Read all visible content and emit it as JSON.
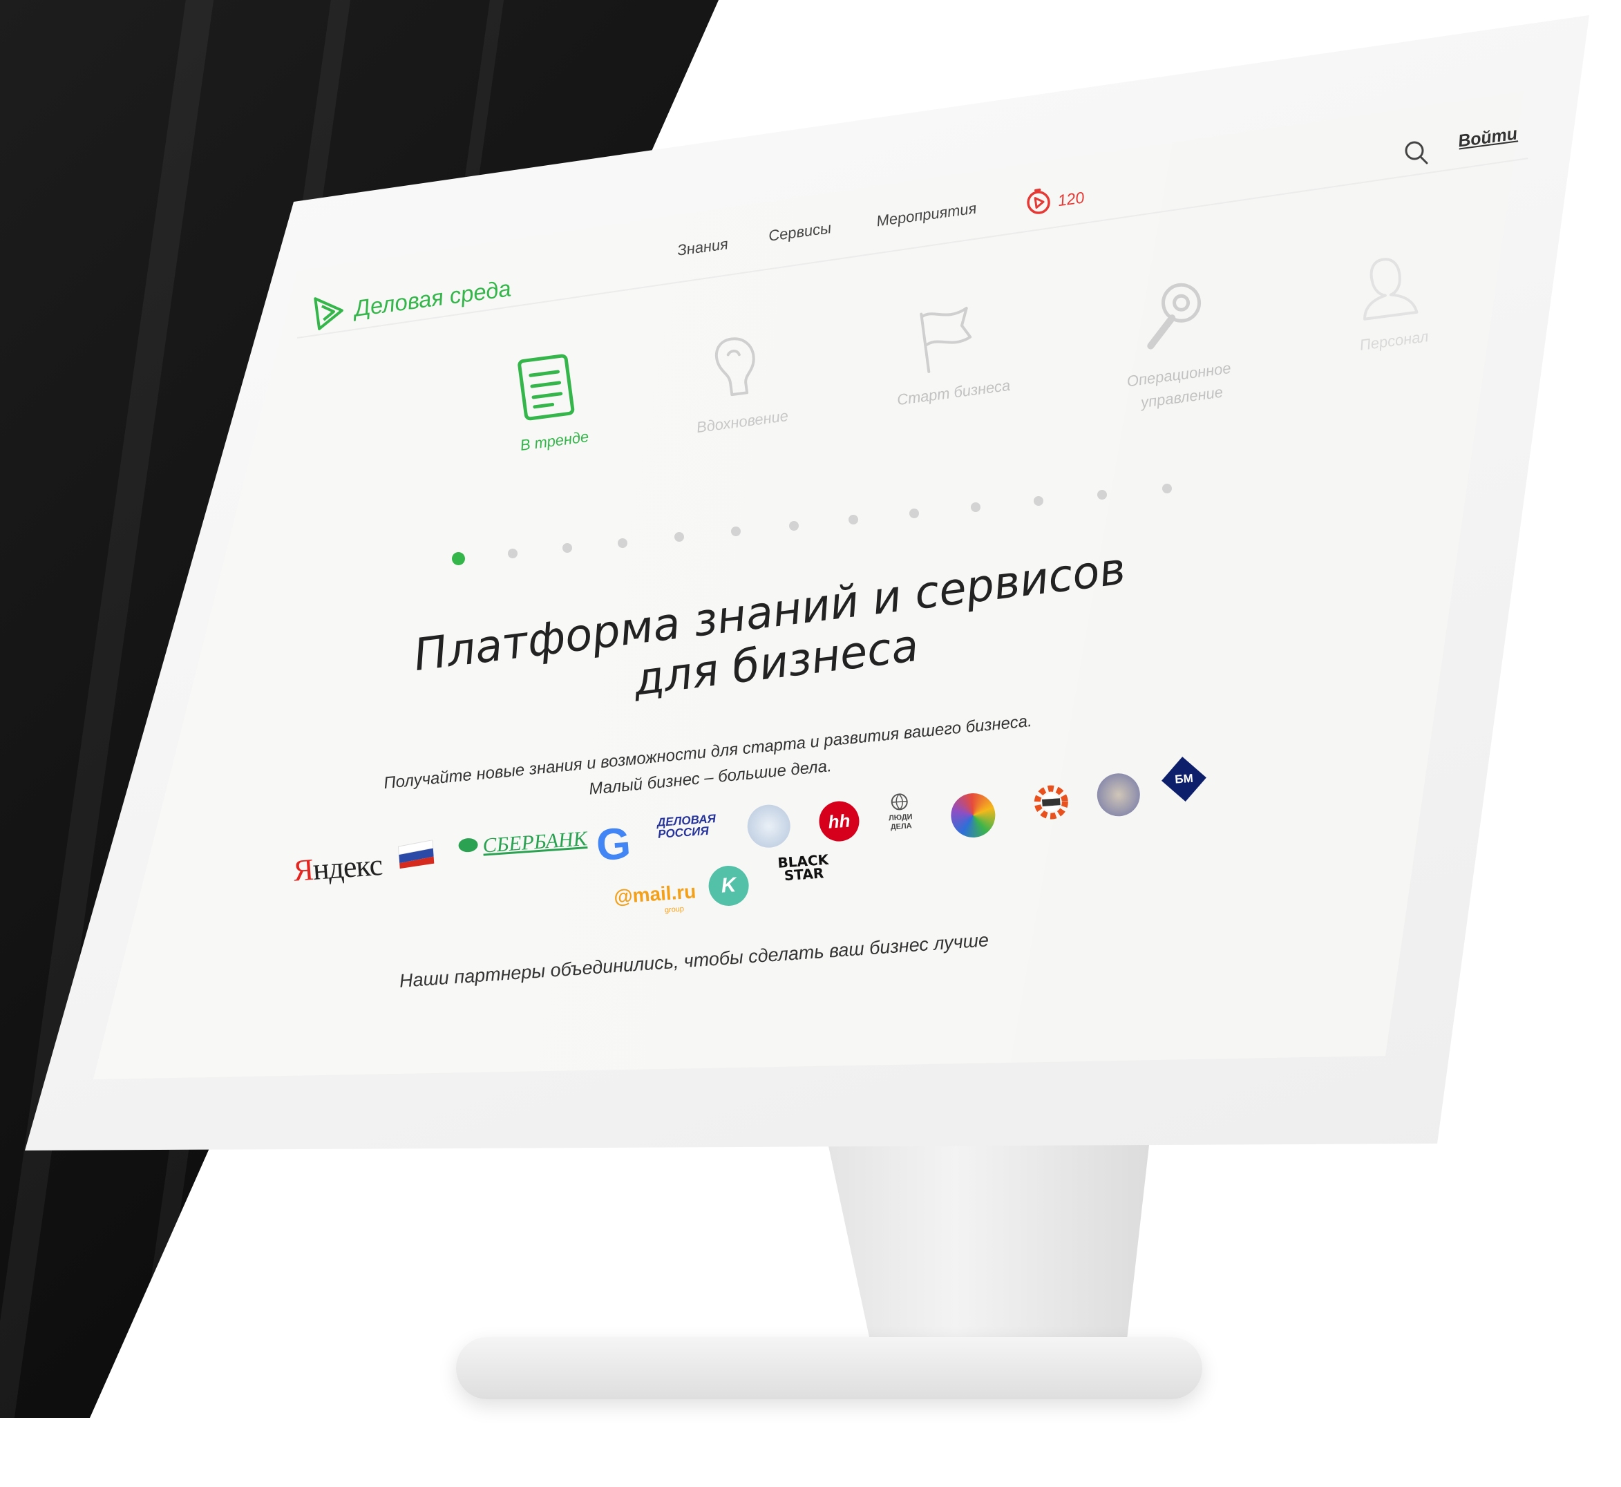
{
  "brand": {
    "name": "Деловая среда"
  },
  "nav": {
    "items": [
      "Знания",
      "Сервисы",
      "Мероприятия"
    ],
    "badge_count": "120",
    "login_label": "Войти"
  },
  "categories": [
    {
      "label": "В тренде",
      "icon": "newspaper-icon",
      "active": true
    },
    {
      "label": "Вдохновение",
      "icon": "lightbulb-head-icon",
      "active": false
    },
    {
      "label": "Старт бизнеса",
      "icon": "flag-icon",
      "active": false
    },
    {
      "label": "Операционное управление",
      "icon": "wrench-gear-icon",
      "active": false
    },
    {
      "label": "Персонал",
      "icon": "person-icon",
      "active": false
    }
  ],
  "carousel": {
    "total_dots": 13,
    "active_index": 0
  },
  "hero": {
    "title_line1": "Платформа знаний и сервисов",
    "title_line2": "для бизнеса",
    "subtitle_line1": "Получайте новые знания и возможности для старта и развития вашего бизнеса.",
    "subtitle_line2": "Малый бизнес – большие дела."
  },
  "partners": {
    "yandex": "Яндекс",
    "sberbank": "СБЕРБАНК",
    "google": "G",
    "delovaya_rossiya_line1": "ДЕЛОВАЯ",
    "delovaya_rossiya_line2": "РОССИЯ",
    "hh": "hh",
    "lyudi_dela_line1": "ЛЮДИ",
    "lyudi_dela_line2": "ДЕЛА",
    "mailru": "@mail.ru",
    "mailru_sub": "group",
    "kontur": "K",
    "blackstar_line1": "BLACK",
    "blackstar_line2": "STAR",
    "bm": "БМ",
    "note": "Наши партнеры объединились, чтобы сделать ваш бизнес лучше"
  },
  "colors": {
    "accent": "#35b64b",
    "badge": "#e53935",
    "text": "#222222",
    "inactive": "#c8c8c8"
  }
}
